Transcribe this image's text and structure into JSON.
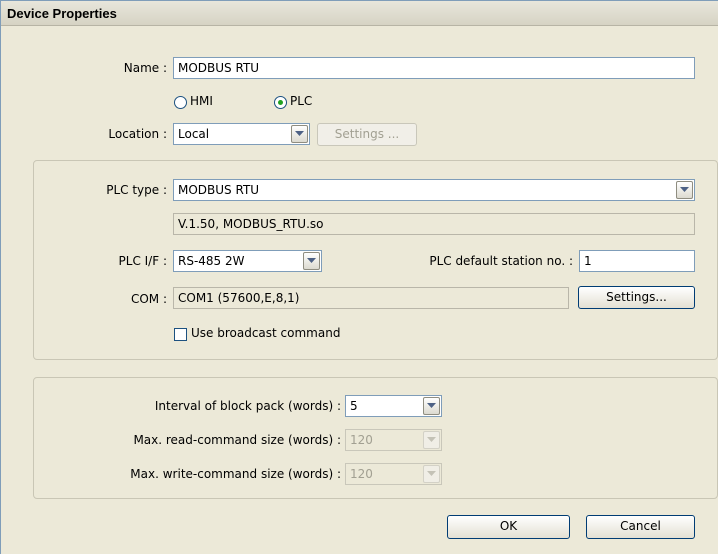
{
  "window": {
    "title": "Device Properties"
  },
  "name": {
    "label": "Name :",
    "value": "MODBUS RTU"
  },
  "device_kind": {
    "options": [
      {
        "label": "HMI",
        "selected": false
      },
      {
        "label": "PLC",
        "selected": true
      }
    ]
  },
  "location": {
    "label": "Location :",
    "value": "Local",
    "settings_label": "Settings ..."
  },
  "plc": {
    "type_label": "PLC type :",
    "type_value": "MODBUS RTU",
    "driver_info": "V.1.50, MODBUS_RTU.so",
    "if_label": "PLC I/F :",
    "if_value": "RS-485 2W",
    "station_label": "PLC default station no. :",
    "station_value": "1",
    "com_label": "COM :",
    "com_value": "COM1 (57600,E,8,1)",
    "com_settings_label": "Settings...",
    "broadcast_label": "Use broadcast command",
    "broadcast_checked": false
  },
  "block": {
    "interval_label": "Interval of block pack (words) :",
    "interval_value": "5",
    "read_label": "Max. read-command size (words) :",
    "read_value": "120",
    "write_label": "Max. write-command size (words) :",
    "write_value": "120"
  },
  "footer": {
    "ok_label": "OK",
    "cancel_label": "Cancel"
  }
}
